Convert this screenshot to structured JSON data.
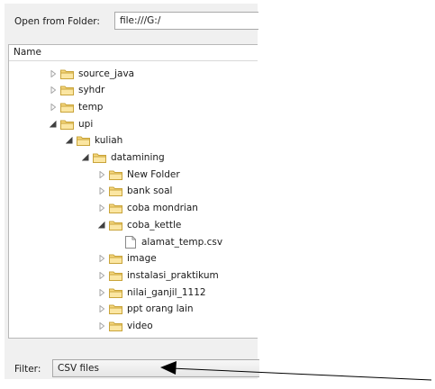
{
  "open_from_folder": {
    "label": "Open from Folder:",
    "value": "file:///G:/"
  },
  "tree": {
    "header": "Name",
    "items": [
      {
        "label": "source_java",
        "type": "folder",
        "state": "collapsed",
        "level": 0
      },
      {
        "label": "syhdr",
        "type": "folder",
        "state": "collapsed",
        "level": 0
      },
      {
        "label": "temp",
        "type": "folder",
        "state": "collapsed",
        "level": 0
      },
      {
        "label": "upi",
        "type": "folder",
        "state": "expanded",
        "level": 0
      },
      {
        "label": "kuliah",
        "type": "folder",
        "state": "expanded",
        "level": 1
      },
      {
        "label": "datamining",
        "type": "folder",
        "state": "expanded",
        "level": 2
      },
      {
        "label": "New Folder",
        "type": "folder",
        "state": "collapsed",
        "level": 3
      },
      {
        "label": "bank soal",
        "type": "folder",
        "state": "collapsed",
        "level": 3
      },
      {
        "label": "coba mondrian",
        "type": "folder",
        "state": "collapsed",
        "level": 3
      },
      {
        "label": "coba_kettle",
        "type": "folder",
        "state": "expanded",
        "level": 3
      },
      {
        "label": "alamat_temp.csv",
        "type": "file",
        "state": "none",
        "level": 4
      },
      {
        "label": "image",
        "type": "folder",
        "state": "collapsed",
        "level": 3
      },
      {
        "label": "instalasi_praktikum",
        "type": "folder",
        "state": "collapsed",
        "level": 3
      },
      {
        "label": "nilai_ganjil_1112",
        "type": "folder",
        "state": "collapsed",
        "level": 3
      },
      {
        "label": "ppt orang lain",
        "type": "folder",
        "state": "collapsed",
        "level": 3
      },
      {
        "label": "video",
        "type": "folder",
        "state": "collapsed",
        "level": 3
      }
    ]
  },
  "filter": {
    "label": "Filter:",
    "value": "CSV files"
  },
  "icons": {
    "folder": "folder-icon",
    "file": "file-icon",
    "collapsed": "expand-arrow-icon",
    "expanded": "collapse-arrow-icon"
  },
  "colors": {
    "folder_fill": "#f6d77e",
    "folder_stroke": "#c9a43a",
    "dialog_bg": "#f0f0f0",
    "annotation_arrow": "#000000"
  }
}
